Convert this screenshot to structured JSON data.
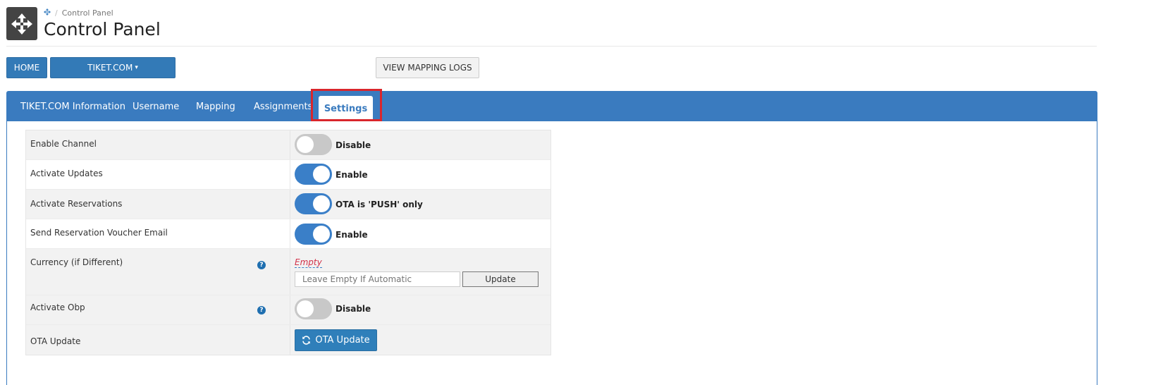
{
  "header": {
    "breadcrumb_home_icon": "move-arrows-icon",
    "breadcrumb_current": "Control Panel",
    "title": "Control Panel",
    "logo_icon": "move-arrows-icon"
  },
  "toolbar": {
    "home_label": "HOME",
    "tiket_label": "TIKET.COM",
    "tiket_caret": "▾",
    "logs_label": "VIEW MAPPING LOGS"
  },
  "tabs": [
    {
      "label": "TIKET.COM Information"
    },
    {
      "label": "Username"
    },
    {
      "label": "Mapping"
    },
    {
      "label": "Assignments"
    },
    {
      "label": "Settings",
      "active": true
    }
  ],
  "settings": {
    "enable_channel": {
      "label": "Enable Channel",
      "state": "off",
      "text": "Disable"
    },
    "activate_updates": {
      "label": "Activate Updates",
      "state": "on",
      "text": "Enable"
    },
    "activate_reservations": {
      "label": "Activate Reservations",
      "state": "on",
      "text": "OTA is 'PUSH' only"
    },
    "send_voucher": {
      "label": "Send Reservation Voucher Email",
      "state": "on",
      "text": "Enable"
    },
    "currency": {
      "label": "Currency (if Different)",
      "empty_text": "Empty",
      "placeholder": "Leave Empty If Automatic",
      "update_label": "Update",
      "help": "?"
    },
    "activate_obp": {
      "label": "Activate Obp",
      "state": "off",
      "text": "Disable",
      "help": "?"
    },
    "ota_update": {
      "label": "OTA Update",
      "button_label": "OTA Update",
      "button_icon": "refresh-icon"
    }
  },
  "colors": {
    "primary": "#337ab7",
    "panel": "#3a7bbf",
    "toggle_on": "#3a7fc8",
    "toggle_off": "#c8c8c8",
    "highlight": "#d9262c",
    "empty_link": "#d2324a"
  }
}
